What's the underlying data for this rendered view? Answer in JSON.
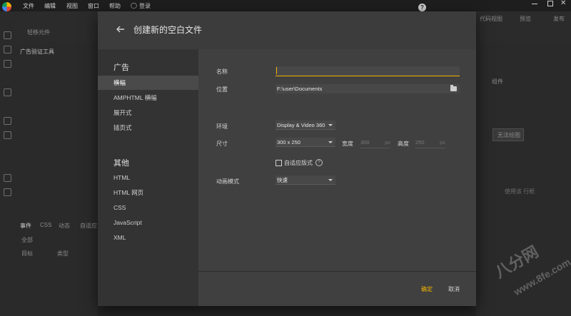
{
  "menubar": {
    "items": [
      "文件",
      "编辑",
      "视图",
      "窗口",
      "帮助"
    ],
    "login": "登录"
  },
  "background": {
    "left_tab": "广告验证工具",
    "left_toolbar_label": "轻移元件",
    "right_labels": [
      "代码视图",
      "预览",
      "发布"
    ],
    "right_tab": "组件",
    "right_button": "无法绘图",
    "right_text": "使用该 行框",
    "bottom_tabs": [
      "事件",
      "CSS",
      "动态",
      "自适应"
    ],
    "bottom_filter": "全部",
    "bottom_cols": [
      "目标",
      "类型"
    ]
  },
  "dialog": {
    "title": "创建新的空白文件",
    "nav": {
      "section_ads": "广告",
      "ads_items": [
        "横幅",
        "AMPHTML 横幅",
        "展开式",
        "插页式"
      ],
      "selected_index": 0,
      "section_other": "其他",
      "other_items": [
        "HTML",
        "HTML 网页",
        "CSS",
        "JavaScript",
        "XML"
      ]
    },
    "form": {
      "name_label": "名称",
      "name_value": "",
      "location_label": "位置",
      "location_value": "F:\\user\\Documents",
      "environment_label": "环境",
      "environment_value": "Display & Video 360",
      "size_label": "尺寸",
      "size_value": "300 x 250",
      "width_label": "宽度",
      "width_value": "300",
      "width_unit": "px",
      "height_label": "高度",
      "height_value": "250",
      "height_unit": "px",
      "responsive_label": "自适应版式",
      "responsive_checked": false,
      "animation_label": "动画模式",
      "animation_value": "快速"
    },
    "footer": {
      "ok_label": "确定",
      "cancel_label": "取消"
    }
  },
  "watermark": {
    "line1": "八分网",
    "line2": "www.8fe.com"
  },
  "colors": {
    "accent": "#f4b400",
    "dialog_bg": "#404040",
    "nav_bg": "#333333"
  }
}
